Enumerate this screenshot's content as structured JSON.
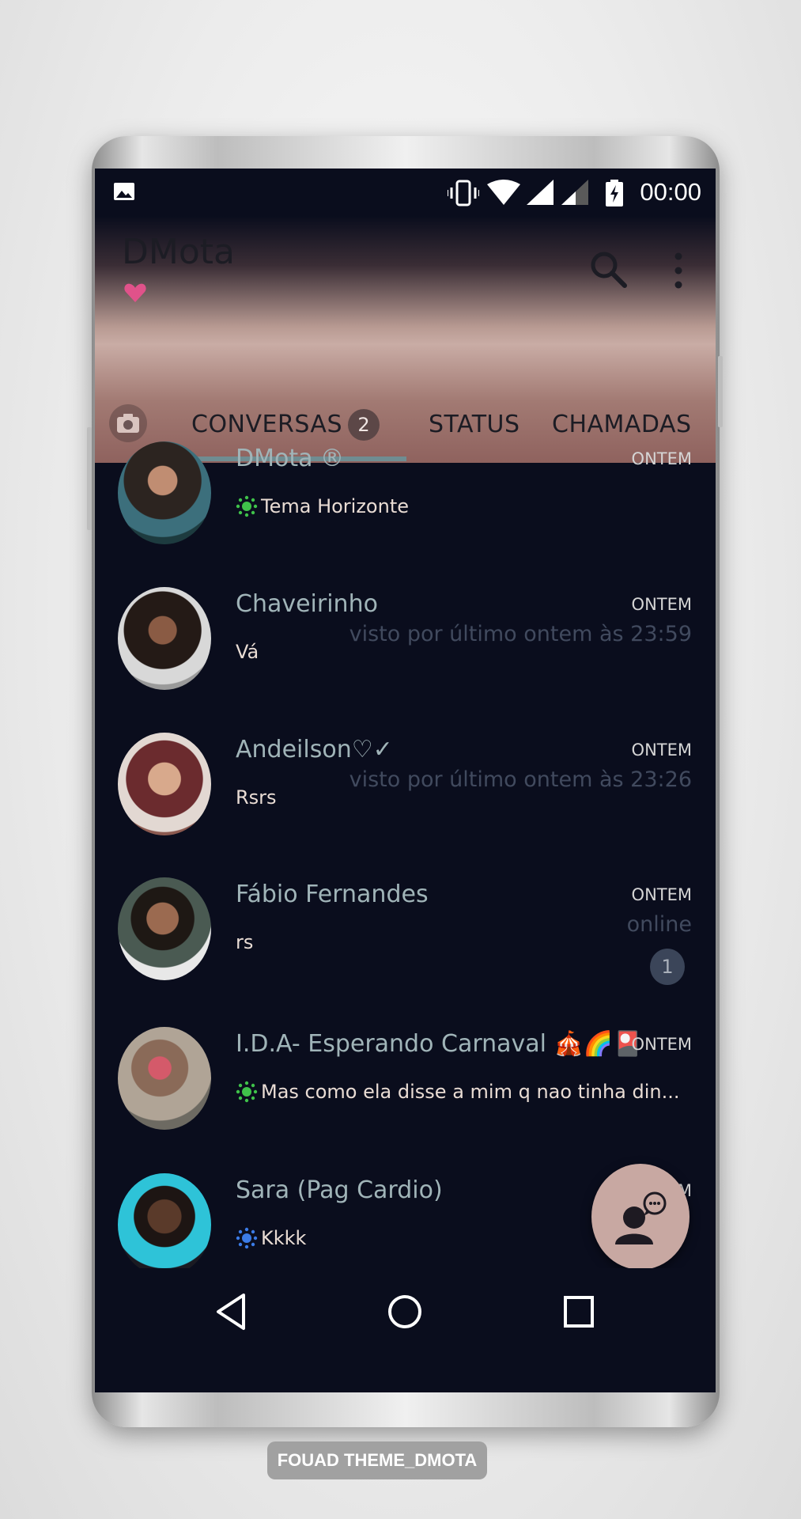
{
  "status_bar": {
    "time": "00:00",
    "icons": [
      "image-icon",
      "vibrate-icon",
      "wifi-icon",
      "signal-icon",
      "signal-weak-icon",
      "battery-charging-icon"
    ]
  },
  "header": {
    "title": "DMota",
    "title_decoration": "heart-icon",
    "actions": [
      "search-icon",
      "more-vert-icon"
    ]
  },
  "tabs": {
    "camera_icon": "camera-icon",
    "conversas": "CONVERSAS",
    "conversas_badge": "2",
    "status": "STATUS",
    "chamadas": "CHAMADAS"
  },
  "chats": [
    {
      "name": "DMota ®",
      "time": "ONTEM",
      "message": "Tema Horizonte",
      "message_icon": "sun-green-icon"
    },
    {
      "name": "Chaveirinho",
      "time": "ONTEM",
      "presence": "visto por último ontem às 23:59",
      "message": "Vá"
    },
    {
      "name": "Andeilson♡✓",
      "time": "ONTEM",
      "presence": "visto por último ontem às 23:26",
      "message": "Rsrs"
    },
    {
      "name": "Fábio Fernandes",
      "time": "ONTEM",
      "presence": "online",
      "message": "rs",
      "unread": "1"
    },
    {
      "name": "I.D.A- Esperando Carnaval 🎪🌈🎴",
      "time": "ONTEM",
      "message": "Mas como ela disse a mim q nao tinha din...",
      "message_icon": "sun-green-icon"
    },
    {
      "name": "Sara (Pag Cardio)",
      "time": "ONTEM",
      "message": "Kkkk",
      "message_icon": "sun-blue-icon"
    }
  ],
  "fab": {
    "icon": "new-chat-contact-icon"
  },
  "nav": {
    "back": "back-icon",
    "home": "home-icon",
    "recents": "recents-icon"
  },
  "watermark": "FOUAD THEME_DMOTA",
  "colors": {
    "background": "#0a0d1d",
    "accent": "#6f8d92",
    "header_rose": "#c9aca5",
    "fab": "#c8a8a2"
  }
}
